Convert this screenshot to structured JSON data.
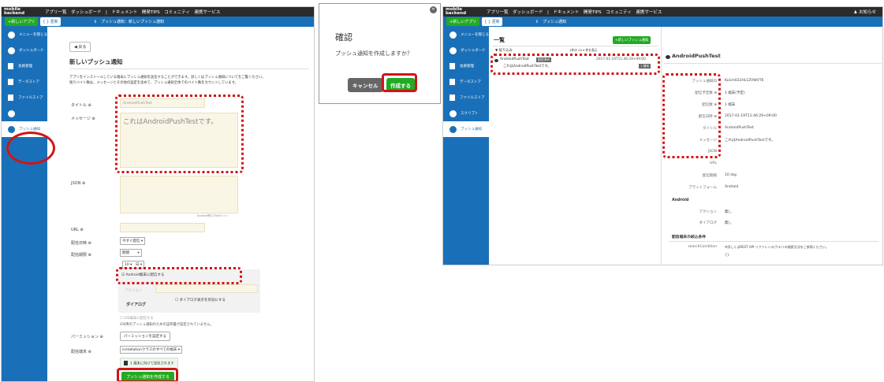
{
  "left_panel": {
    "topbar": {
      "logo": "mobile backend",
      "nav": "アプリ一覧　ダッシュボード　|　ドキュメント　開発TIPS　コミュニティ　連携サービス"
    },
    "subbar": {
      "new_app": "+新しいアプリ",
      "refresh": "{ } 更新",
      "breadcrumb": "⇕　プッシュ通知：新しいプッシュ通知"
    },
    "sidebar": [
      "メニューを隠じる",
      "ダッシュボード",
      "会員管理",
      "データストア",
      "ファイルストア",
      "",
      "プッシュ通知"
    ],
    "back": "◀ 戻る",
    "heading": "新しいプッシュ通知",
    "desc1": "アプリをインストールしている端末にプッシュ通知を送信することができます。詳しくはプッシュ通知についてをご覧ください。",
    "desc2": "残りバイト数は、メッセージとその他の設定を含めて、プッシュ通知全体でのバイト数をカウントしています。",
    "title_label": "タイトル ⊕",
    "title_value": "AndroidPushTest",
    "message_label": "メッセージ ⊕",
    "message_value": "これはAndroidPushTestです。",
    "json_label": "JSON ⊕",
    "json_counter": "Android残り3946バイト",
    "url_label": "URL ⊕",
    "date_label": "配信日時 ⊕",
    "date_value": "今すぐ配信 ▾",
    "period_label": "配信期限 ⊕",
    "period_value": "期間　　 ▾",
    "period_value2": "10 ▾　日 ▾",
    "android_check": "☑ Android端末に配信する",
    "action_label": "アクション",
    "dialog_label": "ダイアログ",
    "dialog_check": "☐ ダイアログ表示を有効にする",
    "ios_check": "☐ iOS端末に配信する",
    "ios_note": "iOS用のプッシュ通知のための証明書が設定されていません。",
    "permission_label": "パーミッション ⊕",
    "permission_button": "パーミッションを設定する",
    "target_label": "配信端末 ⊕",
    "target_value": "installationクラスのすべての端末 ▾",
    "target_note": "1 端末に向けて送信されます",
    "create_button": "プッシュ通知を作成する"
  },
  "dialog": {
    "title": "確認",
    "message": "プッシュ通知を作成しますか？",
    "cancel": "キャンセル",
    "create": "作成する",
    "close": "✕"
  },
  "right_panel": {
    "topbar": {
      "logo": "mobile backend",
      "nav": "アプリ一覧　ダッシュボード　|　ドキュメント　開発TIPS　コミュニティ　連携サービス",
      "notice": "♟ お知らせ"
    },
    "subbar": {
      "new_app": "+新しいアプリ",
      "refresh": "{ } 更新",
      "breadcrumb": "⇕　プッシュ通知"
    },
    "sidebar": [
      "メニューを隠じる",
      "ダッシュボード",
      "会員管理",
      "データストア",
      "ファイルストア",
      "スクリプト",
      "プッシュ通知"
    ],
    "list_title": "一覧",
    "new_push": "+新しいプッシュ通知",
    "filter": "▼ 絞り込み",
    "per_page": "1件の 20 ▾ 件を表示",
    "item_title": "AndroidPushTest",
    "item_badge": "配信済み",
    "item_date": "2017-01-19T11:46:29+09:00",
    "item_msg": "これはAndroidPushTestです。",
    "item_count": "1 端末",
    "detail_title": "AndroidPushTest",
    "details": [
      {
        "k": "プッシュ通知ID",
        "v": "Ko1m022HL1ZVWVT6"
      },
      {
        "k": "配信予定数 ⊕",
        "v": "1 端末(予定)"
      },
      {
        "k": "配信数 ⊕",
        "v": "1 端末"
      },
      {
        "k": "配信日時 ⊕",
        "v": "2017-01-19T11:46:29+09:00"
      },
      {
        "k": "タイトル",
        "v": "AndroidPushTest"
      },
      {
        "k": "メッセージ",
        "v": "これはAndroidPushTestです。"
      },
      {
        "k": "JSON",
        "v": ""
      },
      {
        "k": "URL",
        "v": ""
      },
      {
        "k": "配信期限",
        "v": "10 day"
      },
      {
        "k": "プラットフォーム",
        "v": "Android"
      }
    ],
    "android_head": "Android",
    "action_k": "アクション",
    "action_v": "無し",
    "dialog_k": "ダイアログ",
    "dialog_v": "無し",
    "condition_head": "配信端末の絞込条件",
    "search_k": "searchCondition",
    "search_v": "※詳しくはREST API リファレンス/クエリの検索方法をご参照ください。",
    "search_braces": "{}"
  },
  "colors": {
    "blue": "#1a70b8",
    "green": "#22aa22",
    "red": "#d01515"
  }
}
